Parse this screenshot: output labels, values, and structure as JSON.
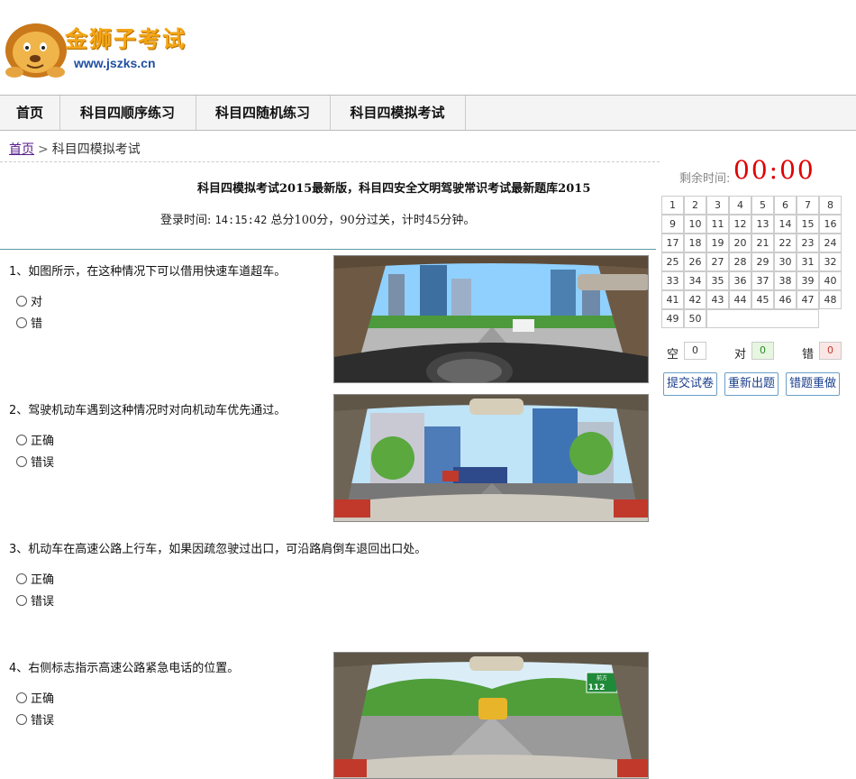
{
  "header": {
    "logo_title": "金狮子考试",
    "logo_url": "www.jszks.cn"
  },
  "nav": {
    "items": [
      {
        "label": "首页"
      },
      {
        "label": "科目四顺序练习"
      },
      {
        "label": "科目四随机练习"
      },
      {
        "label": "科目四模拟考试"
      }
    ]
  },
  "breadcrumb": {
    "home": "首页",
    "separator": ">",
    "current": "科目四模拟考试"
  },
  "exam": {
    "title": "科目四模拟考试2015最新版，科目四安全文明驾驶常识考试最新题库2015",
    "login_label": "登录时间:",
    "login_time": "14:15:42",
    "rules": "总分100分，90分过关，计时45分钟。"
  },
  "questions": [
    {
      "text": "1、如图所示，在这种情况下可以借用快速车道超车。",
      "options": [
        "对",
        "错"
      ]
    },
    {
      "text": "2、驾驶机动车遇到这种情况时对向机动车优先通过。",
      "options": [
        "正确",
        "错误"
      ]
    },
    {
      "text": "3、机动车在高速公路上行车，如果因疏忽驶过出口，可沿路肩倒车退回出口处。",
      "options": [
        "正确",
        "错误"
      ]
    },
    {
      "text": "4、右侧标志指示高速公路紧急电话的位置。",
      "options": [
        "正确",
        "错误"
      ]
    }
  ],
  "q4_sign": {
    "top": "前方",
    "number": "112"
  },
  "sidebar": {
    "timer_label": "剩余时间:",
    "timer": "00:00",
    "grid": [
      "1",
      "2",
      "3",
      "4",
      "5",
      "6",
      "7",
      "8",
      "9",
      "10",
      "11",
      "12",
      "13",
      "14",
      "15",
      "16",
      "17",
      "18",
      "19",
      "20",
      "21",
      "22",
      "23",
      "24",
      "25",
      "26",
      "27",
      "28",
      "29",
      "30",
      "31",
      "32",
      "33",
      "34",
      "35",
      "36",
      "37",
      "38",
      "39",
      "40",
      "41",
      "42",
      "43",
      "44",
      "45",
      "46",
      "47",
      "48",
      "49",
      "50"
    ],
    "stats": {
      "empty_label": "空",
      "empty_value": "0",
      "right_label": "对",
      "right_value": "0",
      "wrong_label": "错",
      "wrong_value": "0"
    },
    "buttons": {
      "submit": "提交试卷",
      "regenerate": "重新出题",
      "redo_wrong": "错题重做"
    }
  },
  "colors": {
    "timer": "#e00000",
    "right_bg": "#e6f6e0",
    "right_text": "#2d8a2d",
    "wrong_bg": "#fbe6e6",
    "wrong_text": "#c0392b",
    "button_border": "#6aa0c8"
  }
}
